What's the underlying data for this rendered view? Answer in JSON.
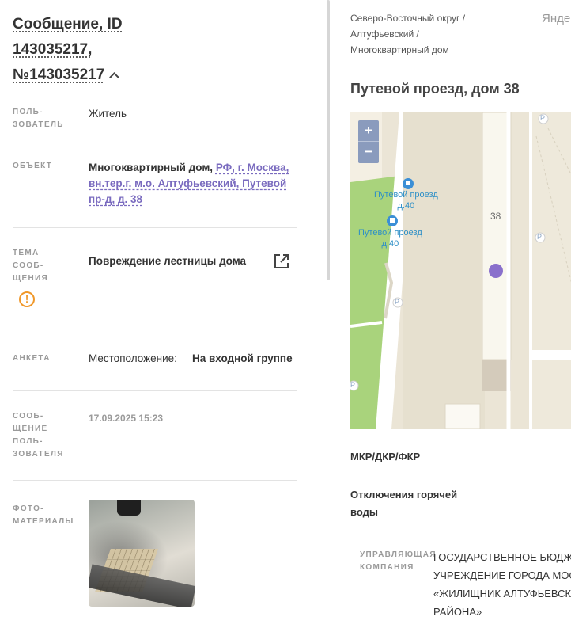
{
  "message": {
    "title_line1": "Сообщение, ID",
    "title_line2": "143035217,",
    "title_line3": "№143035217"
  },
  "fields": {
    "user": {
      "label": "ПОЛЬ-\nЗОВАТЕЛЬ",
      "value": "Житель"
    },
    "object": {
      "label": "ОБЪЕКТ",
      "value_prefix": "Многоквартирный дом,",
      "link_line1": "РФ, г. Москва,",
      "link_line2": "вн.тер.г. м.о. Алтуфьевский, Путевой",
      "link_line3": "пр-д, д. 38"
    },
    "topic": {
      "label": "ТЕМА\nСООБ-\nЩЕНИЯ",
      "value": "Повреждение лестницы дома",
      "warning_icon": "!"
    },
    "survey": {
      "label": "АНКЕТА",
      "key": "Местоположение:",
      "value": "На входной группе"
    },
    "user_message": {
      "label": "СООБ-\nЩЕНИЕ\nПОЛЬ-\nЗОВАТЕЛЯ",
      "value": "17.09.2025 15:23"
    },
    "photos": {
      "label": "ФОТО-\nМАТЕРИАЛЫ"
    }
  },
  "right": {
    "breadcrumb_line1": "Северо-Восточный округ /",
    "breadcrumb_line2": "Алтуфьевский /",
    "breadcrumb_line3": "Многоквартирный дом",
    "side_text": "Янде",
    "address": "Путевой проезд, дом 38",
    "map": {
      "zoom_in": "+",
      "zoom_out": "−",
      "stop1": "Путевой проезд",
      "stop1b": "д.40",
      "stop2": "Путевой проезд",
      "stop2b": "д.40",
      "house_number": "38",
      "parking": "P"
    },
    "mkr": "МКР/ДКР/ФКР",
    "hot_water": "Отключения горячей воды",
    "management": {
      "label": "УПРАВЛЯЮЩАЯ\nКОМПАНИЯ",
      "value": "ГОСУДАРСТВЕННОЕ БЮДЖЕТНОЕ УЧРЕЖДЕНИЕ ГОРОДА МОСКВЫ «ЖИЛИЩНИК АЛТУФЬЕВСКОГО РАЙОНА»"
    }
  },
  "colors": {
    "link": "#7a6bbf",
    "warning": "#f0982a",
    "map_marker": "#8a70cc",
    "map_road": "#ffffff",
    "map_park": "#a9d37c"
  }
}
